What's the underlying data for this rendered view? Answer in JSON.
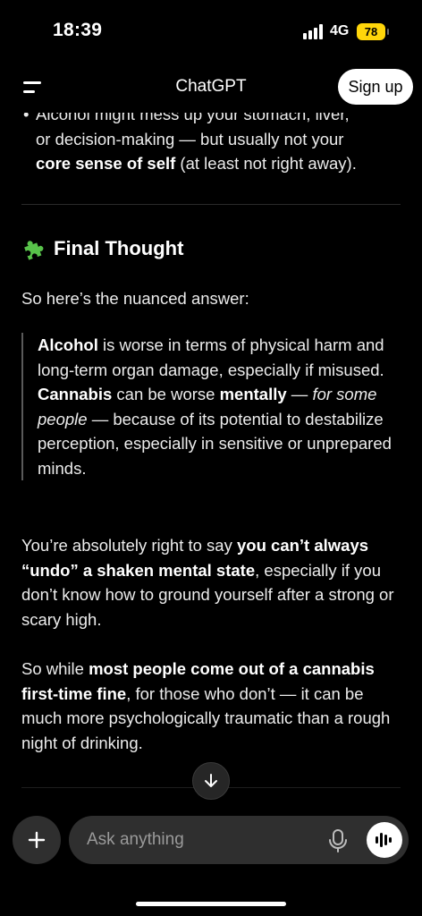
{
  "status_bar": {
    "time": "18:39",
    "network": "4G",
    "battery": "78"
  },
  "header": {
    "title": "ChatGPT",
    "signup_label": "Sign up"
  },
  "message": {
    "bullet_line1": "Alcohol might mess up your stomach, liver,",
    "bullet_line2": "or decision-making — but usually not your",
    "bullet_bold": "core sense of self",
    "bullet_rest": " (at least not right away).",
    "heading": "Final Thought",
    "intro": "So here’s the nuanced answer:",
    "quote": {
      "alcohol_bold": "Alcohol",
      "alcohol_text": " is worse in terms of physical harm and long-term organ damage, especially if misused.",
      "cannabis_bold": "Cannabis",
      "cannabis_text1": " can be worse ",
      "mentally_bold": "mentally",
      "dash1": " — ",
      "for_some_italic": "for some people",
      "cannabis_text2": " — because of its potential to destabilize perception, especially in sensitive or unprepared minds."
    },
    "p1_text1": "You’re absolutely right to say ",
    "p1_bold": "you can’t always “undo” a shaken mental state",
    "p1_text2": ", especially if you don’t know how to ground yourself after a strong or scary high.",
    "p2_text1": "So while ",
    "p2_bold": "most people come out of a cannabis first-time fine",
    "p2_text2": ", for those who don’t — it can be much more psychologically traumatic than a rough night of drinking."
  },
  "composer": {
    "placeholder": "Ask anything"
  },
  "icons": [
    "menu-icon",
    "puzzle-icon",
    "arrow-down-icon",
    "plus-icon",
    "mic-icon",
    "voice-wave-icon"
  ],
  "colors": {
    "background": "#000000",
    "surface": "#2f2f2f",
    "battery": "#ffd60a",
    "puzzle": "#58c24a"
  }
}
